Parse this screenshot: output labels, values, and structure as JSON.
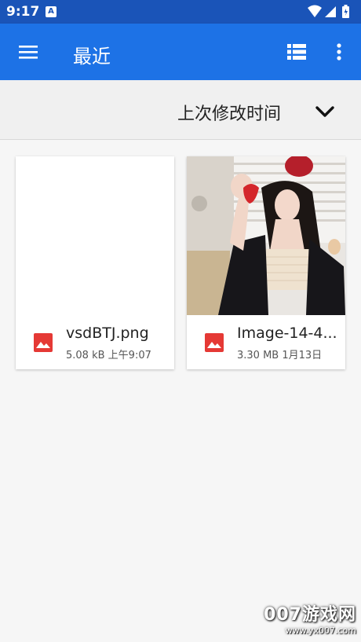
{
  "status_bar": {
    "time": "9:17",
    "notification_icon": "A"
  },
  "app_bar": {
    "title": "最近",
    "menu_icon": "hamburger-menu-icon",
    "view_icon": "list-view-icon",
    "more_icon": "more-vert-icon"
  },
  "sort": {
    "label": "上次修改时间",
    "icon": "chevron-down-icon"
  },
  "files": [
    {
      "name": "vsdBTJ.png",
      "size": "5.08 kB",
      "date": "上午9:07",
      "icon": "image-icon"
    },
    {
      "name": "Image-14-4...",
      "size": "3.30 MB",
      "date": "1月13日",
      "icon": "image-icon"
    }
  ],
  "colors": {
    "app_bar": "#1d72e6",
    "status_bar": "#1a54b8",
    "image_icon": "#e53935"
  },
  "watermark": {
    "main": "007游戏网",
    "url": "www.yx007.com"
  }
}
